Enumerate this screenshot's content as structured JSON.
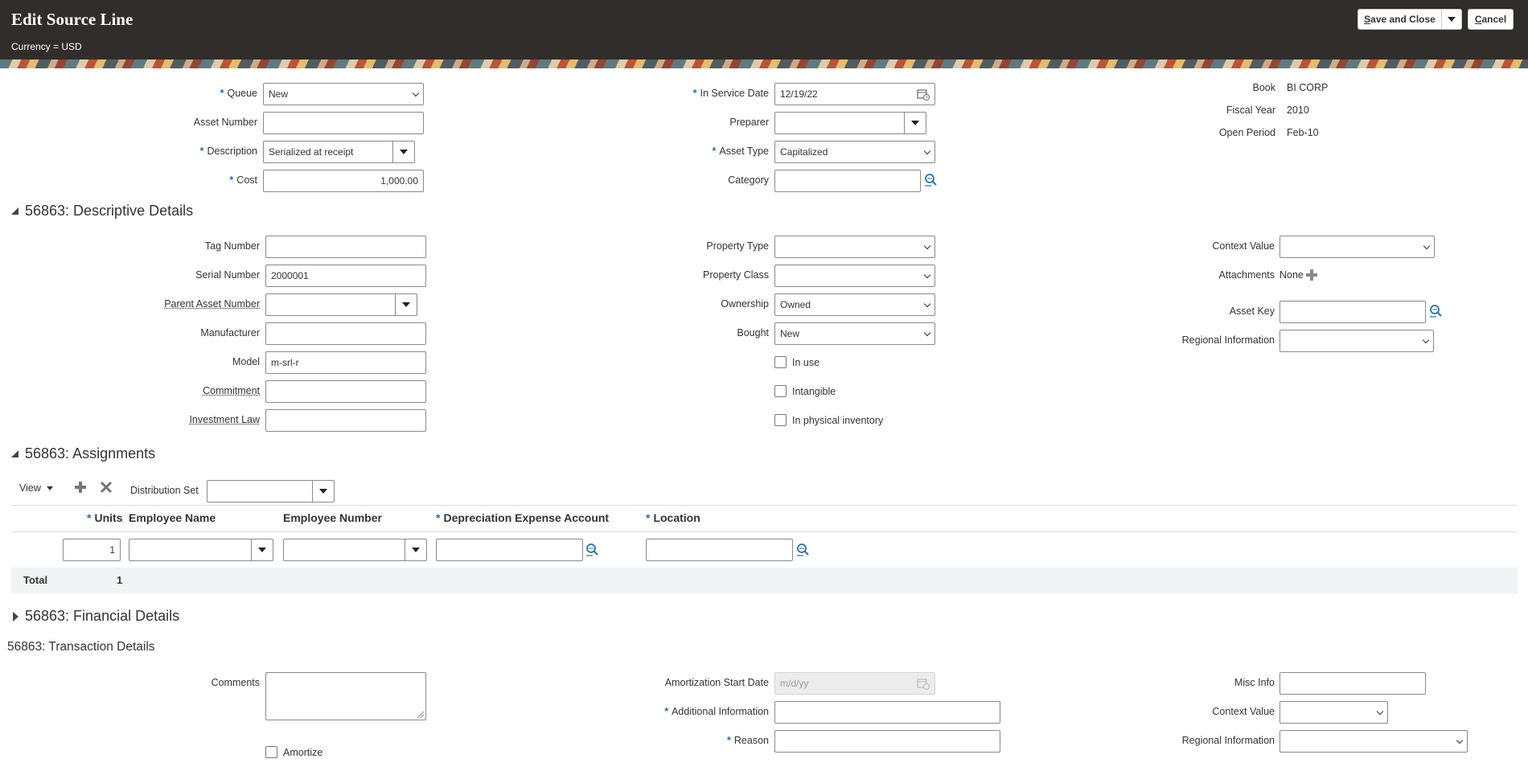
{
  "header": {
    "title": "Edit Source Line",
    "subtitle": "Currency = USD",
    "save_prefix": "S",
    "save_rest": "ave and Close",
    "cancel_prefix": "C",
    "cancel_rest": "ancel"
  },
  "top_form": {
    "queue_label": "Queue",
    "queue_value": "New",
    "asset_number_label": "Asset Number",
    "asset_number_value": "",
    "description_label": "Description",
    "description_value": "Serialized at receipt",
    "cost_label": "Cost",
    "cost_value": "1,000.00",
    "in_service_date_label": "In Service Date",
    "in_service_date_value": "12/19/22",
    "preparer_label": "Preparer",
    "preparer_value": "",
    "asset_type_label": "Asset Type",
    "asset_type_value": "Capitalized",
    "category_label": "Category",
    "category_value": "",
    "book_label": "Book",
    "book_value": "BI CORP",
    "fiscal_year_label": "Fiscal Year",
    "fiscal_year_value": "2010",
    "open_period_label": "Open Period",
    "open_period_value": "Feb-10"
  },
  "descriptive": {
    "title": "56863: Descriptive Details",
    "tag_number_label": "Tag Number",
    "tag_number_value": "",
    "serial_number_label": "Serial Number",
    "serial_number_value": "2000001",
    "parent_asset_number_label": "Parent Asset Number",
    "parent_asset_number_value": "",
    "manufacturer_label": "Manufacturer",
    "manufacturer_value": "",
    "model_label": "Model",
    "model_value": "m-srl-r",
    "commitment_label": "Commitment",
    "commitment_value": "",
    "investment_law_label": "Investment Law",
    "investment_law_value": "",
    "property_type_label": "Property Type",
    "property_type_value": "",
    "property_class_label": "Property Class",
    "property_class_value": "",
    "ownership_label": "Ownership",
    "ownership_value": "Owned",
    "bought_label": "Bought",
    "bought_value": "New",
    "in_use_label": "In use",
    "intangible_label": "Intangible",
    "in_physical_inventory_label": "In physical inventory",
    "context_value_label": "Context Value",
    "context_value_value": "",
    "attachments_label": "Attachments",
    "attachments_value": "None",
    "asset_key_label": "Asset Key",
    "asset_key_value": "",
    "regional_information_label": "Regional Information",
    "regional_information_value": ""
  },
  "assignments": {
    "title": "56863: Assignments",
    "view_label": "View",
    "distribution_set_label": "Distribution Set",
    "distribution_set_value": "",
    "columns": {
      "units": "Units",
      "employee_name": "Employee Name",
      "employee_number": "Employee Number",
      "depreciation_expense_account": "Depreciation Expense Account",
      "location": "Location"
    },
    "row": {
      "units": "1",
      "employee_name": "",
      "employee_number": "",
      "depreciation_expense_account": "",
      "location": ""
    },
    "total_label": "Total",
    "total_value": "1"
  },
  "financial": {
    "title": "56863: Financial Details"
  },
  "transaction": {
    "title": "56863: Transaction Details",
    "comments_label": "Comments",
    "comments_value": "",
    "amortize_label": "Amortize",
    "amortization_start_date_label": "Amortization Start Date",
    "amortization_start_date_placeholder": "m/d/yy",
    "additional_information_label": "Additional Information",
    "additional_information_value": "",
    "reason_label": "Reason",
    "reason_value": "",
    "misc_info_label": "Misc Info",
    "misc_info_value": "",
    "context_value_label": "Context Value",
    "context_value_value": "",
    "regional_information_label": "Regional Information",
    "regional_information_value": ""
  },
  "colors": {
    "header_bg": "#302d2a",
    "required_asterisk": "#1d6fb8",
    "search_icon": "#2a6fb0"
  }
}
